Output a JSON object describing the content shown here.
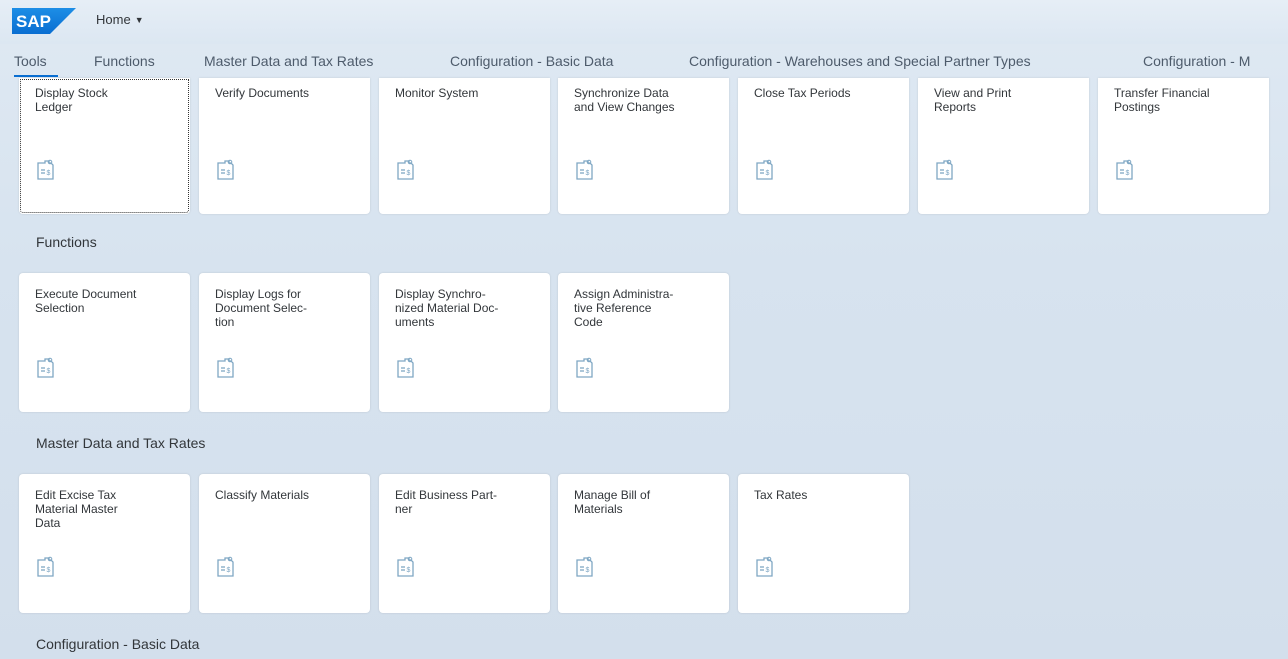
{
  "shell": {
    "logo_text": "SAP",
    "home_label": "Home",
    "colors": {
      "brand": "#0a6ed1",
      "tile_icon": "#7fa7c4",
      "text": "#32363a"
    }
  },
  "anchor_bar": {
    "items": [
      "Tools",
      "Functions",
      "Master Data and Tax Rates",
      "Configuration - Basic Data",
      "Configuration - Warehouses and Special Partner Types",
      "Configuration - M"
    ],
    "selected": "Tools"
  },
  "groups": {
    "tools": {
      "tiles": [
        {
          "title": "Display Stock\nLedger",
          "icon": "report-icon"
        },
        {
          "title": "Verify Documents",
          "icon": "report-icon"
        },
        {
          "title": "Monitor System",
          "icon": "report-icon"
        },
        {
          "title": "Synchronize Data\nand View Changes",
          "icon": "report-icon"
        },
        {
          "title": "Close Tax Periods",
          "icon": "report-icon"
        },
        {
          "title": "View and Print\nReports",
          "icon": "report-icon"
        },
        {
          "title": "Transfer Financial\nPostings",
          "icon": "report-icon"
        }
      ]
    },
    "functions": {
      "title": "Functions",
      "tiles": [
        {
          "title": "Execute Document\nSelection",
          "icon": "report-icon"
        },
        {
          "title": "Display Logs for\nDocument Selec-\ntion",
          "icon": "report-icon"
        },
        {
          "title": "Display Synchro-\nnized Material Doc-\numents",
          "icon": "report-icon"
        },
        {
          "title": "Assign Administra-\ntive Reference\nCode",
          "icon": "report-icon"
        }
      ]
    },
    "master_data": {
      "title": "Master Data and Tax Rates",
      "tiles": [
        {
          "title": "Edit Excise Tax\nMaterial Master\nData",
          "icon": "report-icon"
        },
        {
          "title": "Classify Materials",
          "icon": "report-icon"
        },
        {
          "title": "Edit Business Part-\nner",
          "icon": "report-icon"
        },
        {
          "title": "Manage Bill of\nMaterials",
          "icon": "report-icon"
        },
        {
          "title": "Tax Rates",
          "icon": "report-icon"
        }
      ]
    },
    "config_basic": {
      "title": "Configuration - Basic Data"
    }
  }
}
